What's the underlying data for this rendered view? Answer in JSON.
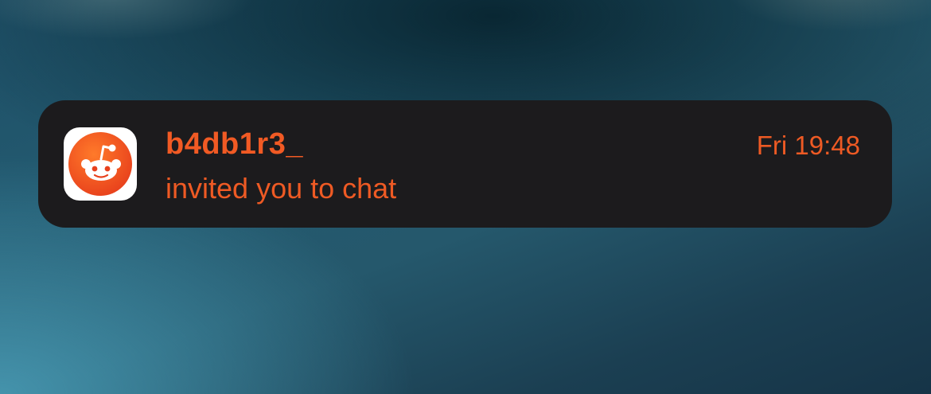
{
  "notification": {
    "app_icon": "reddit-app-icon",
    "sender": "b4db1r3_",
    "message": "invited you to chat",
    "timestamp": "Fri 19:48"
  },
  "colors": {
    "accent": "#f15a24",
    "card_background": "#1c1b1d",
    "icon_background": "#ffffff"
  }
}
